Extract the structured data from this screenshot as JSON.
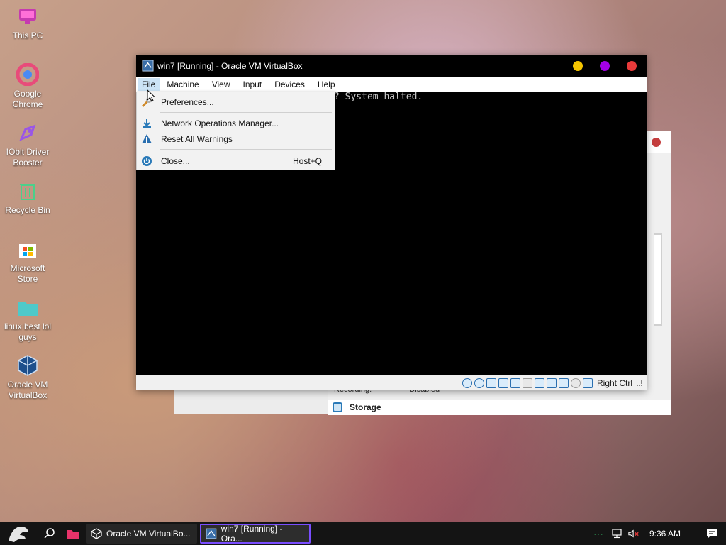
{
  "desktop": {
    "icons": [
      {
        "label": "This PC",
        "icon": "this-pc-icon"
      },
      {
        "label": "Google Chrome",
        "icon": "chrome-icon"
      },
      {
        "label": "IObit Driver Booster",
        "icon": "driver-booster-icon"
      },
      {
        "label": "Recycle Bin",
        "icon": "recycle-bin-icon"
      },
      {
        "label": "Microsoft Store",
        "icon": "store-icon"
      },
      {
        "label": "linux best lol guys",
        "icon": "folder-icon"
      },
      {
        "label": "Oracle VM VirtualBox",
        "icon": "virtualbox-icon"
      }
    ]
  },
  "vm_window": {
    "title": "win7 [Running] - Oracle VM VirtualBox",
    "menu": [
      "File",
      "Machine",
      "View",
      "Input",
      "Devices",
      "Help"
    ],
    "console_text": "? System halted.",
    "host_key": "Right Ctrl",
    "title_dot_colors": [
      "#f5c400",
      "#a400e6",
      "#e83a3a"
    ]
  },
  "file_menu": {
    "items": [
      {
        "label": "Preferences...",
        "shortcut": "",
        "icon": "preferences-icon"
      },
      {
        "label": "Network Operations Manager...",
        "shortcut": "",
        "icon": "download-icon"
      },
      {
        "label": "Reset All Warnings",
        "shortcut": "",
        "icon": "warning-icon"
      },
      {
        "label": "Close...",
        "shortcut": "Host+Q",
        "icon": "power-icon"
      }
    ]
  },
  "background_window": {
    "recording_label": "Recording:",
    "recording_value": "Disabled",
    "section": "Storage"
  },
  "taskbar": {
    "tasks": [
      {
        "label": "Oracle VM VirtualBo..."
      },
      {
        "label": "win7 [Running] - Ora..."
      }
    ],
    "clock": "9:36 AM",
    "accent": "#7a4dff"
  }
}
